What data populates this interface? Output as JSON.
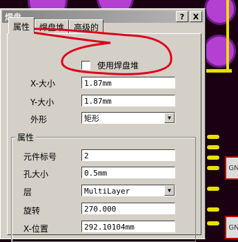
{
  "dialog": {
    "title": "焊盘",
    "help_button": "?",
    "close_button": "X"
  },
  "tabs": [
    {
      "label": "属性",
      "active": true
    },
    {
      "label": "焊盘堆",
      "active": false
    },
    {
      "label": "高级的",
      "active": false
    }
  ],
  "use_pad_stack": {
    "label": "使用焊盘堆",
    "checked": false
  },
  "size": {
    "x_label": "X-大小",
    "x_value": "1.87mm",
    "y_label": "Y-大小",
    "y_value": "1.87mm",
    "shape_label": "外形",
    "shape_value": "矩形"
  },
  "properties": {
    "group_label": "属性",
    "designator_label": "元件标号",
    "designator_value": "2",
    "hole_label": "孔大小",
    "hole_value": "0.5mm",
    "layer_label": "层",
    "layer_value": "MultiLayer",
    "rotation_label": "旋转",
    "rotation_value": "270.000",
    "xpos_label": "X-位置",
    "xpos_value": "292.10104mm"
  },
  "pcb": {
    "gnd_labels": [
      "GN",
      "GN"
    ]
  },
  "colors": {
    "annotation_red": "#e0001a",
    "pcb_background": "#1a0010",
    "pad_purple": "#b53fd1",
    "trace_yellow": "#e8e000"
  }
}
